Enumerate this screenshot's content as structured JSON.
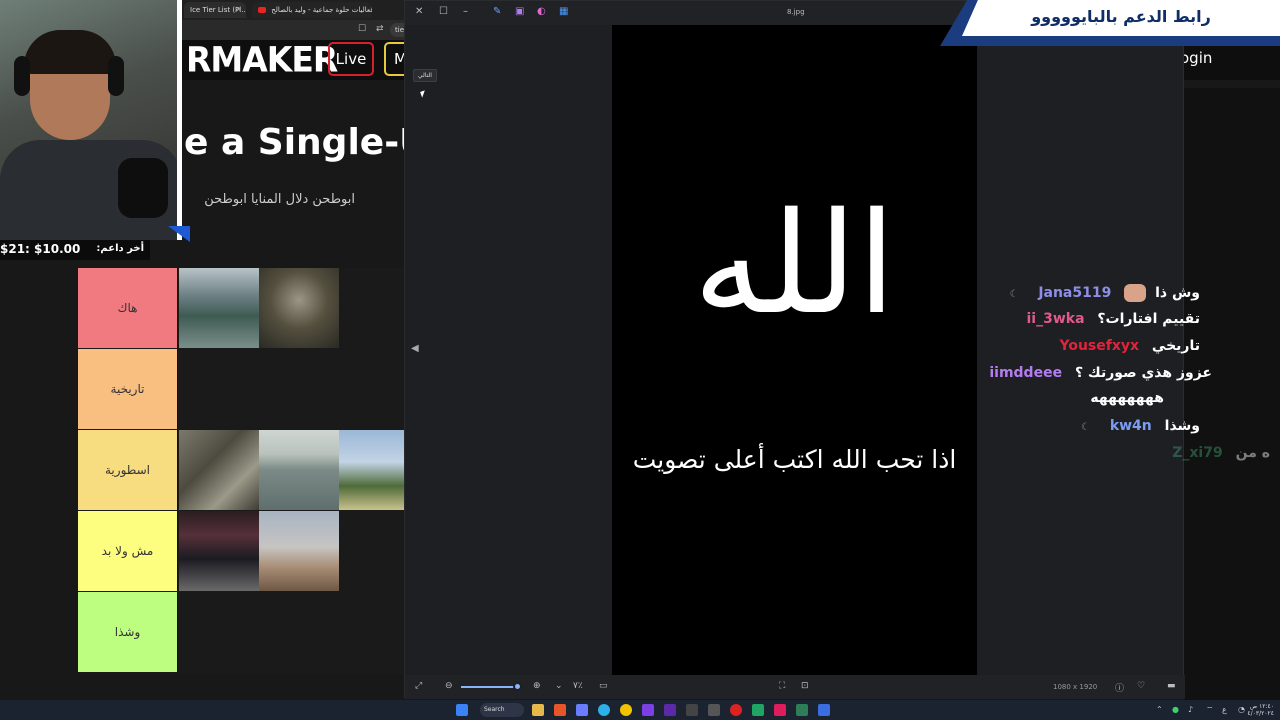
{
  "browser": {
    "tabs": [
      {
        "label": "Ice Tier List (Pl..."
      },
      {
        "label": "تشغيل فعاليات حلوة جماعية - وليد بالصالح"
      }
    ],
    "url": "tierm",
    "site_logo": "RMAKER",
    "nav_live": "Live",
    "nav_m": "M",
    "login": "ogin",
    "heading": "e a Single-U",
    "description": "ابوطحن دلال المنايا ابوطحن لا"
  },
  "tiers": [
    {
      "label": "هاك",
      "color": "#f07a7f",
      "images": [
        {
          "name": "lake-mountains-image",
          "bg": "linear-gradient(#b8c3c8 0%, #6d7f84 35%, #3e5b52 60%, #7b8f8a 100%)"
        },
        {
          "name": "sinkhole-road-image",
          "bg": "radial-gradient(circle at 50% 40%, #9b9685 0%, #55503f 45%, #2a2a24 100%)"
        }
      ]
    },
    {
      "label": "تاريخية",
      "color": "#f9bf81",
      "images": []
    },
    {
      "label": "اسطورية",
      "color": "#f8dd80",
      "images": [
        {
          "name": "rocky-shore-image",
          "bg": "linear-gradient(135deg, #7c7a6c 0%, #4d4a40 40%, #9b9988 70%, #3e3b33 100%)"
        },
        {
          "name": "sea-horizon-image",
          "bg": "linear-gradient(#cfd6d2 0%, #b9c2bc 30%, #7b8a86 50%, #5f6f6d 100%)"
        },
        {
          "name": "palm-trees-image",
          "bg": "linear-gradient(#9bb8d8 0%, #c3d3e4 40%, #4f6b3a 70%, #c9c28c 100%)"
        }
      ]
    },
    {
      "label": "مش ولا بد",
      "color": "#fdfd7f",
      "images": [
        {
          "name": "cinema-room-image",
          "bg": "linear-gradient(#2a1d20 0%, #56303a 30%, #1b1b22 60%, #6a6a6a 100%)"
        },
        {
          "name": "yellow-flower-image",
          "bg": "linear-gradient(#a8b4c3 0%, #c6c5c2 45%, #a98e76 70%, #6e5844 100%)"
        }
      ]
    },
    {
      "label": "وشذا",
      "color": "#bdfd7f",
      "images": []
    }
  ],
  "donor": {
    "label": "أخر داعم:",
    "amount": "$21: $10.00"
  },
  "banner": {
    "text": "رابط الدعم بالبايووووو"
  },
  "viewer": {
    "filename": "8.jpg",
    "tooltip": "التالي",
    "image_main_text": "الله",
    "image_caption": "اذا تحب الله اكتب أعلى تصويت",
    "zoom_label": "٧٪",
    "dimensions": "1080 x 1920"
  },
  "chat": [
    {
      "user": "Jana5119",
      "color": "#8e8ee6",
      "text": "وش ذا",
      "emote": true,
      "badge": true
    },
    {
      "user": "ii_3wka",
      "color": "#e05a8a",
      "text": "تقييم افتارات؟",
      "emote": false,
      "badge": false
    },
    {
      "user": "Yousefxyx",
      "color": "#e0243c",
      "text": "تاريخي",
      "emote": false,
      "badge": false
    },
    {
      "user": "iimddeee",
      "color": "#b47cf0",
      "text": "عزوز هذي صورتك ؟",
      "emote": false,
      "badge": false
    },
    {
      "user": "",
      "color": "#ffffff",
      "text": "هههههههه",
      "emote": false,
      "badge": false
    },
    {
      "user": "kw4n",
      "color": "#7c9cf0",
      "text": "وشذا",
      "emote": false,
      "badge": true
    }
  ],
  "chat_partial": {
    "user": "Z_xi79",
    "text": "ه من"
  },
  "taskbar": {
    "search": "Search",
    "clock_time": "١٢:٤٠ ص",
    "clock_date": "٤/٠٣/٢٠٢٤"
  }
}
